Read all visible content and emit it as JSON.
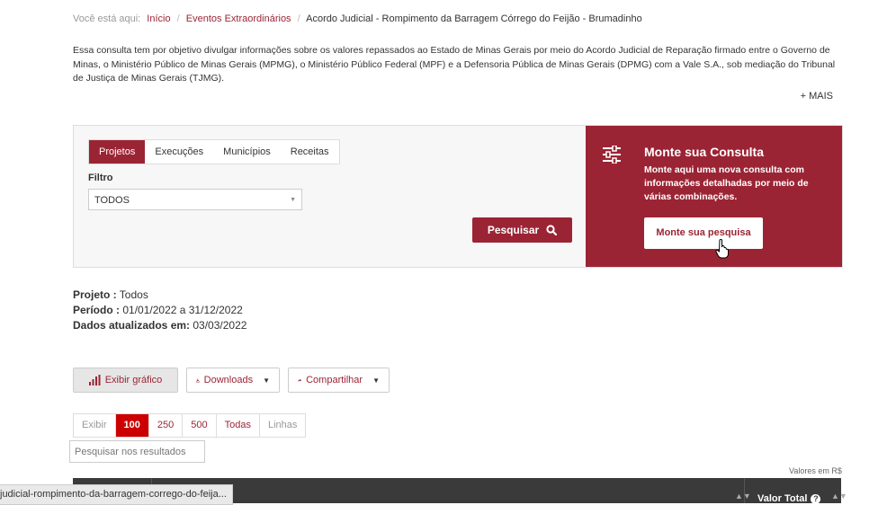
{
  "breadcrumb": {
    "prefix": "Você está aqui:",
    "items": [
      "Início",
      "Eventos Extraordinários",
      "Acordo Judicial - Rompimento da Barragem Córrego do Feijão - Brumadinho"
    ]
  },
  "intro": "Essa consulta tem por objetivo divulgar informações sobre os valores repassados ao Estado de Minas Gerais por meio do Acordo Judicial de Reparação firmado entre o Governo de Minas, o Ministério Público de Minas Gerais (MPMG), o Ministério Público Federal (MPF) e a Defensoria Pública de Minas Gerais (DPMG) com a Vale S.A., sob mediação do Tribunal de Justiça de Minas Gerais (TJMG).",
  "mais_label": "+ MAIS",
  "tabs": [
    "Projetos",
    "Execuções",
    "Municípios",
    "Receitas"
  ],
  "filter": {
    "label": "Filtro",
    "value": "TODOS"
  },
  "search_button": "Pesquisar",
  "monte": {
    "title": "Monte sua Consulta",
    "description": "Monte aqui uma nova consulta com informações detalhadas por meio de várias combinações.",
    "button": "Monte sua pesquisa"
  },
  "info": {
    "projeto_label": "Projeto :",
    "projeto_value": "Todos",
    "periodo_label": "Período :",
    "periodo_value": "01/01/2022 a 31/12/2022",
    "dados_label": "Dados atualizados em:",
    "dados_value": "03/03/2022"
  },
  "actions": {
    "grafico": "Exibir gráfico",
    "downloads": "Downloads",
    "compartilhar": "Compartilhar"
  },
  "pager": {
    "exibir": "Exibir",
    "options": [
      "100",
      "250",
      "500",
      "Todas"
    ],
    "linhas": "Linhas"
  },
  "results_search_placeholder": "Pesquisar nos resultados",
  "valores_note": "Valores em R$",
  "table": {
    "valor_total": "Valor Total"
  },
  "status_url": "judicial-rompimento-da-barragem-corrego-do-feija...",
  "colors": {
    "primary": "#9b2434",
    "active_page": "#cc0000"
  }
}
